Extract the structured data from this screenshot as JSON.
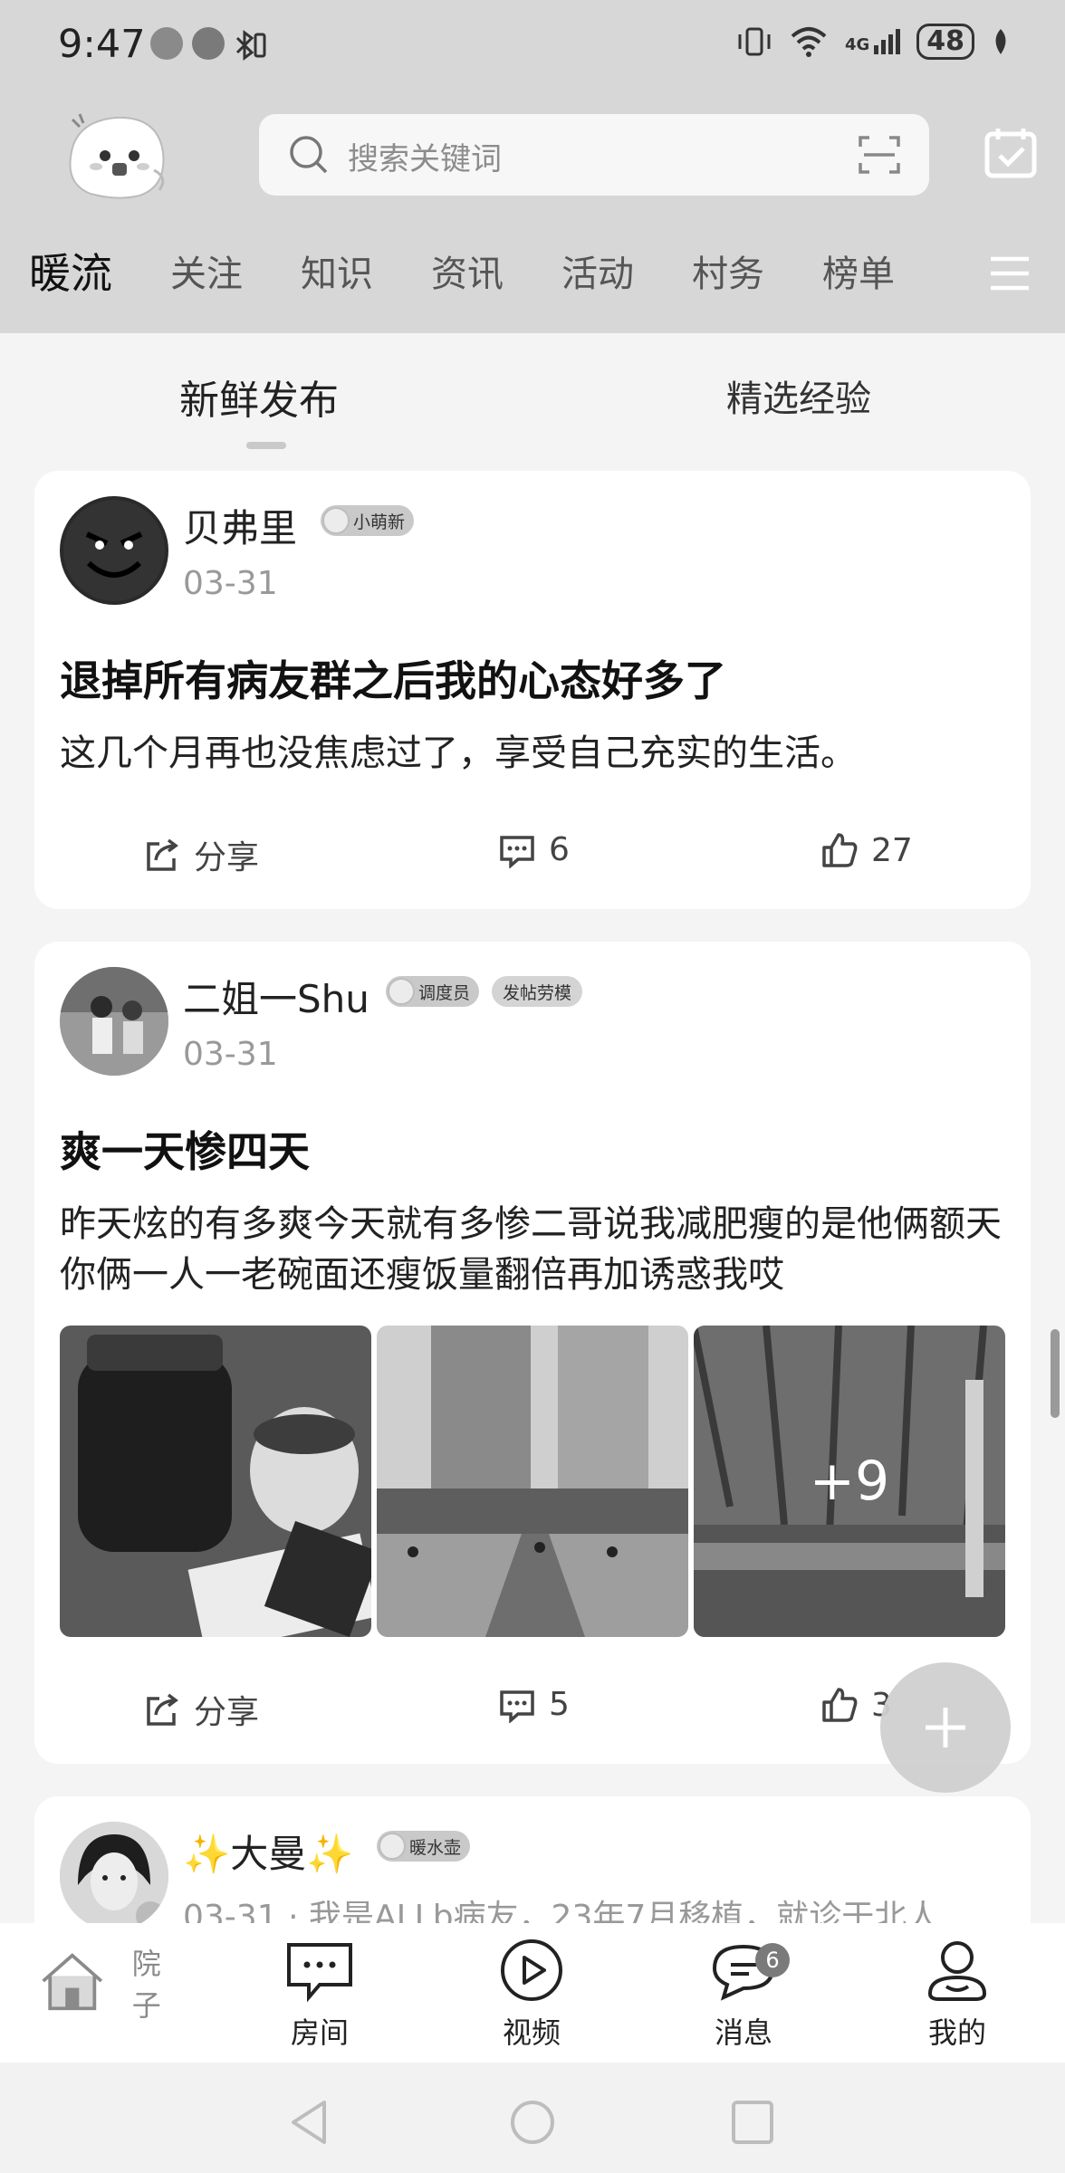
{
  "status_bar": {
    "time": "9:47",
    "battery": "48",
    "network": "4G"
  },
  "search": {
    "placeholder": "搜索关键词"
  },
  "tabs": [
    "暖流",
    "关注",
    "知识",
    "资讯",
    "活动",
    "村务",
    "榜单"
  ],
  "subtabs": [
    "新鲜发布",
    "精选经验"
  ],
  "posts": [
    {
      "author": "贝弗里",
      "badges": [
        "小萌新"
      ],
      "date": "03-31",
      "title": "退掉所有病友群之后我的心态好多了",
      "body": "这几个月再也没焦虑过了，享受自己充实的生活。",
      "share_label": "分享",
      "comments": "6",
      "likes": "27"
    },
    {
      "author": "二姐一Shu",
      "badges": [
        "调度员",
        "发帖劳模"
      ],
      "date": "03-31",
      "title": "爽一天惨四天",
      "body": "昨天炫的有多爽今天就有多惨二哥说我减肥瘦的是他俩额天你俩一人一老碗面还瘦饭量翻倍再加诱惑我哎",
      "more_images": "+9",
      "share_label": "分享",
      "comments": "5",
      "likes": "3"
    },
    {
      "author": "✨大曼✨",
      "badges": [
        "暖水壶"
      ],
      "date": "03-31",
      "snippet": "· 我是ALLb病友，23年7月移植，就诊于北人"
    }
  ],
  "bottom_nav": [
    {
      "label": "院子",
      "icon": "house-icon"
    },
    {
      "label": "房间",
      "icon": "chat-room-icon"
    },
    {
      "label": "视频",
      "icon": "play-icon"
    },
    {
      "label": "消息",
      "icon": "message-icon",
      "badge": "6"
    },
    {
      "label": "我的",
      "icon": "profile-icon"
    }
  ],
  "colors": {
    "header_bg": "#d7d7d7",
    "page_bg": "#f4f4f4",
    "card_bg": "#ffffff",
    "active_nav": "#8a8a8a"
  }
}
